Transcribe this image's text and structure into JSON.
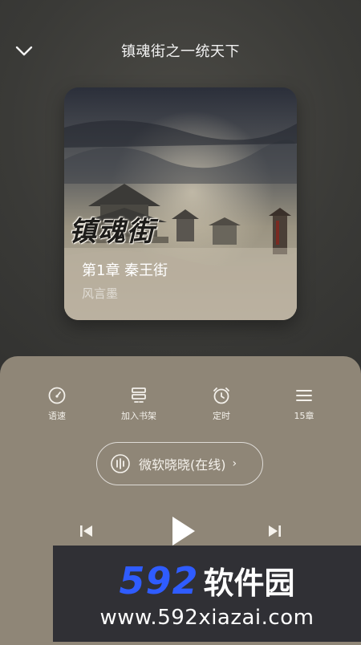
{
  "header": {
    "back_icon": "chevron-down-icon",
    "title": "镇魂街之一统天下"
  },
  "cover": {
    "calligraphy": "镇魂街",
    "chapter": "第1章 秦王街",
    "author": "风言墨"
  },
  "tools": [
    {
      "icon": "speed-gauge-icon",
      "label": "语速"
    },
    {
      "icon": "add-bookshelf-icon",
      "label": "加入书架"
    },
    {
      "icon": "alarm-clock-icon",
      "label": "定时"
    },
    {
      "icon": "menu-list-icon",
      "label": "15章"
    }
  ],
  "voice": {
    "icon": "sound-wave-icon",
    "label": "微软晓晓(在线)",
    "chevron": "›"
  },
  "player": {
    "prev_icon": "skip-previous-icon",
    "play_icon": "play-icon",
    "next_icon": "skip-next-icon"
  },
  "watermark": {
    "brand_number": "592",
    "brand_text": "软件园",
    "url": "www.592xiazai.com",
    "brand_color": "#2f5cff"
  },
  "colors": {
    "panel": "#8f8677",
    "text": "#f3f0ea"
  }
}
